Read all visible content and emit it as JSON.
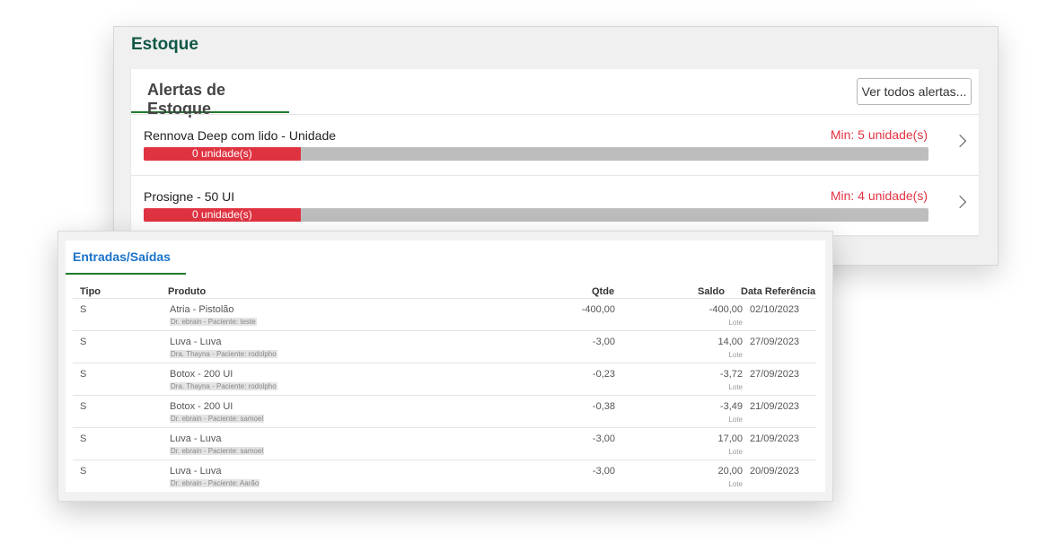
{
  "stock": {
    "title": "Estoque",
    "alerts_tab": "Alertas de Estoque",
    "view_all_button": "Ver todos alertas...",
    "alerts": [
      {
        "name": "Rennova Deep com lido - Unidade",
        "min": "Min: 5 unidade(s)",
        "quantity_label": "0 unidade(s)",
        "level_fraction": 0.2
      },
      {
        "name": "Prosigne - 50 UI",
        "min": "Min: 4 unidade(s)",
        "quantity_label": "0 unidade(s)",
        "level_fraction": 0.2
      }
    ]
  },
  "moves": {
    "tab": "Entradas/Saídas",
    "headers": {
      "tipo": "Tipo",
      "produto": "Produto",
      "qtde": "Qtde",
      "saldo": "Saldo",
      "data": "Data Referência"
    },
    "rows": [
      {
        "tipo": "S",
        "produto": "Atria - Pistolão",
        "detalhe": "Dr. ebrain - Paciente: teste",
        "qtde": "-400,00",
        "saldo": "-400,00",
        "lote": "Lote",
        "data": "02/10/2023"
      },
      {
        "tipo": "S",
        "produto": "Luva - Luva",
        "detalhe": "Dra. Thayna - Paciente: rodolpho",
        "qtde": "-3,00",
        "saldo": "14,00",
        "lote": "Lote",
        "data": "27/09/2023"
      },
      {
        "tipo": "S",
        "produto": "Botox - 200 UI",
        "detalhe": "Dra. Thayna - Paciente: rodolpho",
        "qtde": "-0,23",
        "saldo": "-3,72",
        "lote": "Lote",
        "data": "27/09/2023"
      },
      {
        "tipo": "S",
        "produto": "Botox - 200 UI",
        "detalhe": "Dr. ebrain - Paciente: samoel",
        "qtde": "-0,38",
        "saldo": "-3,49",
        "lote": "Lote",
        "data": "21/09/2023"
      },
      {
        "tipo": "S",
        "produto": "Luva - Luva",
        "detalhe": "Dr. ebrain - Paciente: samoel",
        "qtde": "-3,00",
        "saldo": "17,00",
        "lote": "Lote",
        "data": "21/09/2023"
      },
      {
        "tipo": "S",
        "produto": "Luva - Luva",
        "detalhe": "Dr. ebrain - Paciente: Aarão",
        "qtde": "-3,00",
        "saldo": "20,00",
        "lote": "Lote",
        "data": "20/09/2023"
      }
    ]
  },
  "colors": {
    "brand_green": "#0f5746",
    "tab_underline": "#1e7b2c",
    "alert_red": "#e03341",
    "link_blue": "#1a73c9"
  }
}
